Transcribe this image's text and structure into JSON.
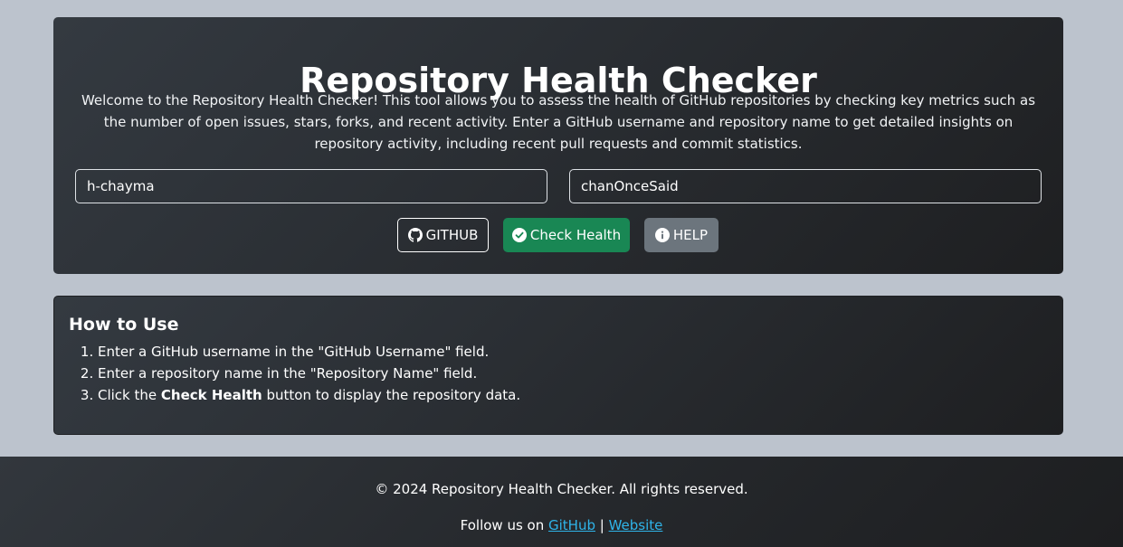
{
  "hero": {
    "title": "Repository Health Checker",
    "intro": "Welcome to the Repository Health Checker! This tool allows you to assess the health of GitHub repositories by checking key metrics such as the number of open issues, stars, forks, and recent activity. Enter a GitHub username and repository name to get detailed insights on repository activity, including recent pull requests and commit statistics.",
    "username_value": "h-chayma",
    "repo_value": "chanOnceSaid",
    "buttons": {
      "github": {
        "label": "GITHUB",
        "icon": "github-icon"
      },
      "check": {
        "label": "Check Health",
        "icon": "check-circle-icon"
      },
      "help": {
        "label": "HELP",
        "icon": "info-circle-icon"
      }
    }
  },
  "howto": {
    "title": "How to Use",
    "steps": [
      {
        "text": "Enter a GitHub username in the \"GitHub Username\" field."
      },
      {
        "text": "Enter a repository name in the \"Repository Name\" field."
      },
      {
        "prefix": "Click the ",
        "bold": "Check Health",
        "suffix": " button to display the repository data."
      }
    ]
  },
  "footer": {
    "copyright": "© 2024 Repository Health Checker. All rights reserved.",
    "follow_prefix": "Follow us on ",
    "separator": " | ",
    "links": [
      {
        "label": "GitHub"
      },
      {
        "label": "Website"
      }
    ]
  },
  "colors": {
    "background": "#bcc3cd",
    "card": "#2a2e33",
    "success": "#198754",
    "secondary": "#6c757d",
    "link": "#2fb4e9"
  }
}
